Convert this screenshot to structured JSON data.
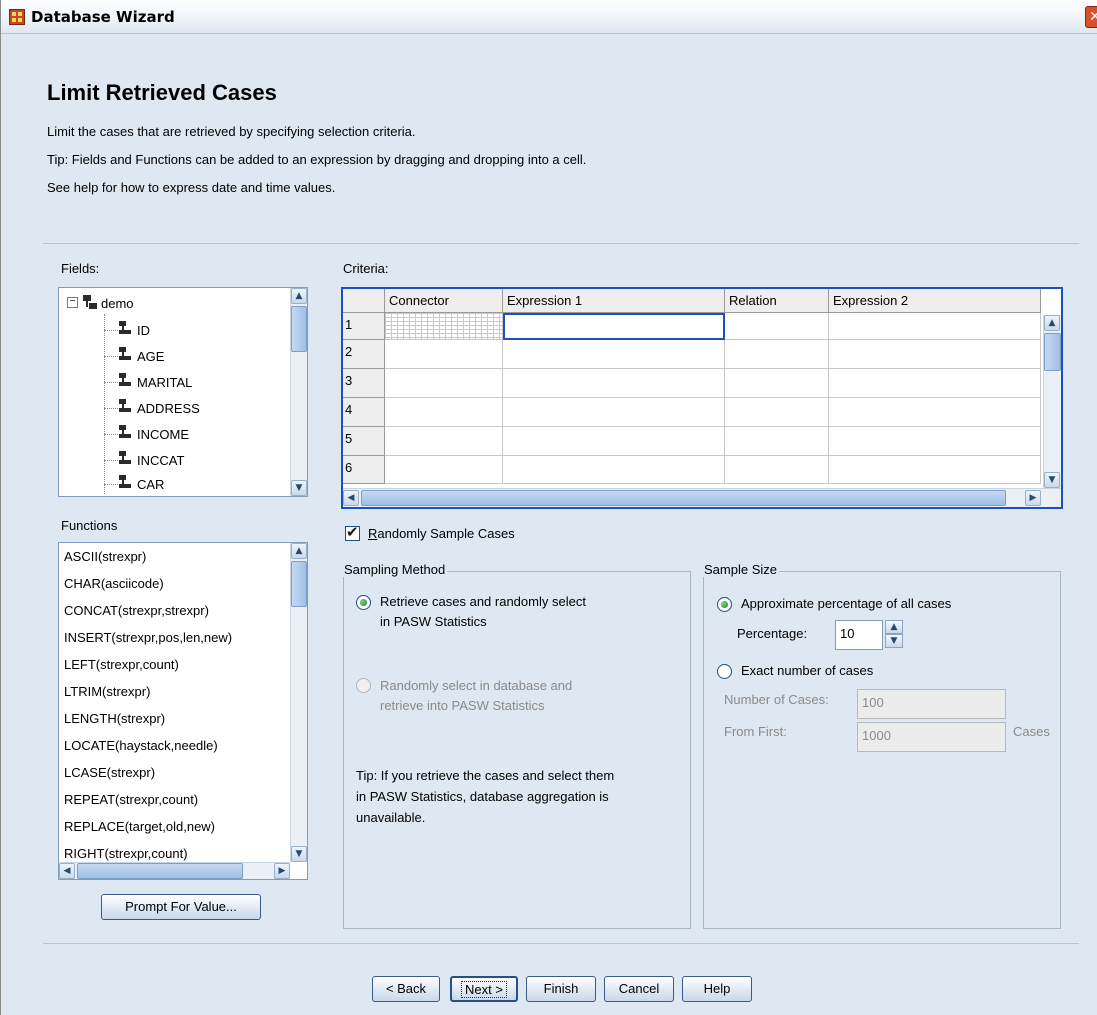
{
  "window": {
    "title": "Database Wizard",
    "close_glyph": "✕"
  },
  "page": {
    "heading": "Limit Retrieved Cases",
    "lines": [
      "Limit the cases that are retrieved by specifying selection criteria.",
      "Tip: Fields and Functions can be added to an expression by dragging and dropping into a cell.",
      "See help for how to express date and time values."
    ]
  },
  "fields": {
    "label": "Fields:",
    "root": "demo",
    "items": [
      "ID",
      "AGE",
      "MARITAL",
      "ADDRESS",
      "INCOME",
      "INCCAT",
      "CAR"
    ]
  },
  "functions": {
    "label": "Functions",
    "items": [
      "ASCII(strexpr)",
      "CHAR(asciicode)",
      "CONCAT(strexpr,strexpr)",
      "INSERT(strexpr,pos,len,new)",
      "LEFT(strexpr,count)",
      "LTRIM(strexpr)",
      "LENGTH(strexpr)",
      "LOCATE(haystack,needle)",
      "LCASE(strexpr)",
      "REPEAT(strexpr,count)",
      "REPLACE(target,old,new)",
      "RIGHT(strexpr,count)"
    ],
    "prompt_button": "Prompt For Value..."
  },
  "criteria": {
    "label": "Criteria:",
    "columns": [
      "Connector",
      "Expression 1",
      "Relation",
      "Expression 2"
    ],
    "rows": [
      "1",
      "2",
      "3",
      "4",
      "5",
      "6"
    ]
  },
  "random_sample": {
    "label": "Randomly Sample Cases",
    "checked": true,
    "check_glyph": "✔"
  },
  "sampling_method": {
    "title": "Sampling Method",
    "option1": {
      "line1": "Retrieve cases and randomly select",
      "line2": "in PASW Statistics",
      "selected": true
    },
    "option2": {
      "line1": "Randomly select in database and",
      "line2": "retrieve into PASW Statistics",
      "enabled": false
    },
    "tip": [
      "Tip: If you retrieve the cases and select them",
      "in PASW Statistics, database aggregation is",
      "unavailable."
    ]
  },
  "sample_size": {
    "title": "Sample Size",
    "approx_label": "Approximate percentage of all cases",
    "percentage_label": "Percentage:",
    "percentage_value": "10",
    "exact_label": "Exact number of cases",
    "num_cases_label": "Number of Cases:",
    "num_cases_value": "100",
    "from_first_label": "From First:",
    "from_first_value": "1000",
    "cases_suffix": "Cases"
  },
  "buttons": {
    "back": "< Back",
    "next": "Next >",
    "finish": "Finish",
    "cancel": "Cancel",
    "help": "Help"
  },
  "glyphs": {
    "up": "▲",
    "down": "▼",
    "left": "◀",
    "right": "▶",
    "minus": "−"
  },
  "colors": {
    "accent": "#1c4fbf",
    "background": "#dde8f3"
  }
}
